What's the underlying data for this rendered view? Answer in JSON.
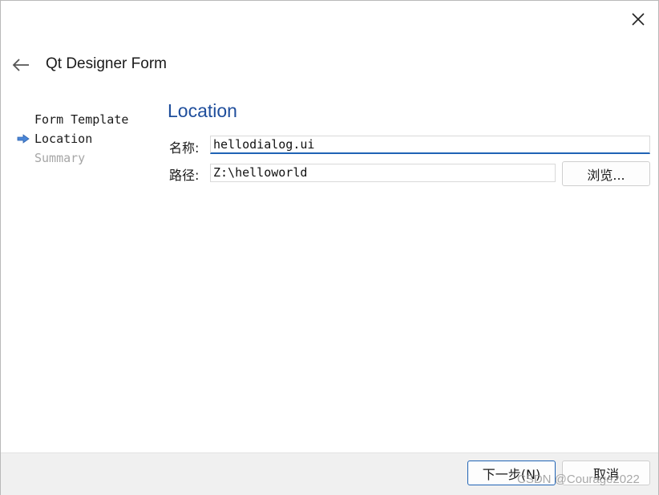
{
  "window": {
    "title": "Qt Designer Form"
  },
  "steps": [
    {
      "label": "Form Template",
      "state": "done"
    },
    {
      "label": "Location",
      "state": "current"
    },
    {
      "label": "Summary",
      "state": "pending"
    }
  ],
  "page": {
    "heading": "Location",
    "name_label": "名称:",
    "name_value": "hellodialog.ui",
    "path_label": "路径:",
    "path_value": "Z:\\helloworld",
    "browse_label": "浏览..."
  },
  "footer": {
    "next_label": "下一步(N)",
    "cancel_label": "取消"
  },
  "watermark": "CSDN @Courage2022",
  "colors": {
    "accent": "#1f4e9c",
    "focus": "#1f63b5",
    "step_arrow": "#4a86d8",
    "disabled_text": "#a6a6a6"
  }
}
